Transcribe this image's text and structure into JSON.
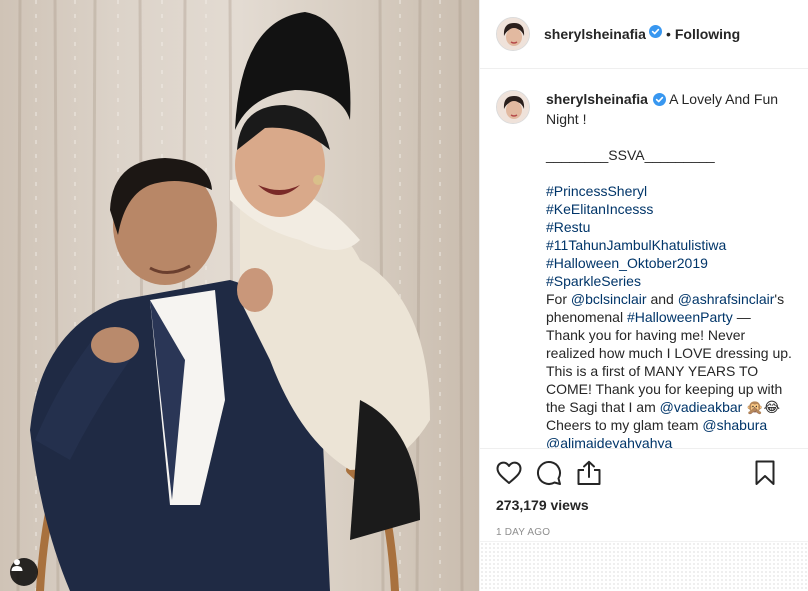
{
  "post": {
    "username": "sherylsheinafia",
    "follow_status": "Following",
    "separator": "•",
    "views": "273,179 views",
    "posted": "1 DAY AGO"
  },
  "caption": {
    "username": "sherylsheinafia",
    "lines": [
      "A Lovely And Fun Night !",
      "________SSVA_________",
      "#PrincessSheryl",
      "#KeElitanIncesss",
      "#Restu",
      "#11TahunJambulKhatulistiwa",
      "#Halloween_Oktober2019",
      "#SparkleSeries",
      "For",
      "@bclsinclair",
      "and",
      "@ashrafsinclair",
      "'s phenomenal",
      "#HalloweenParty",
      "— Thank you for having me! Never realized how much I LOVE dressing up. This is a first of MANY YEARS TO COME! Thank you for keeping up with the Sagi that I am",
      "@vadieakbar",
      "🙊😂",
      "Cheers to my glam team",
      "@shabura",
      "@alimajdeyahyahya"
    ]
  },
  "icons": {
    "like": "heart-icon",
    "comment": "comment-icon",
    "share": "share-icon",
    "save": "bookmark-icon",
    "verified": "verified-badge-icon",
    "photo_user": "user-tag-icon"
  },
  "colors": {
    "text": "#262626",
    "hashtag": "#003569",
    "muted": "#8e8e8e",
    "verified": "#3897f0",
    "border": "#efefef"
  }
}
